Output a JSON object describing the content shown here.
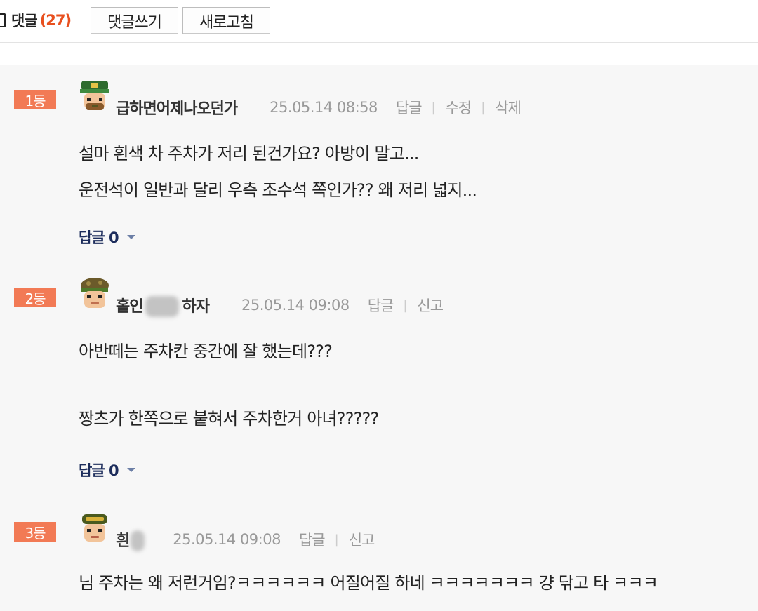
{
  "header": {
    "title": "댓글",
    "count": "(27)",
    "write_button": "댓글쓰기",
    "refresh_button": "새로고침"
  },
  "colors": {
    "rank_badge": "#f27a55",
    "count": "#e8501f",
    "reply_toggle": "#1d2d5c"
  },
  "comments": [
    {
      "rank": "1등",
      "nickname": "급하면어제나오던가",
      "date": "25.05.14 08:58",
      "actions": [
        "답글",
        "수정",
        "삭제"
      ],
      "lines": [
        "설마 흰색 차 주차가 저리 된건가요? 아방이 말고...",
        "운전석이 일반과 달리 우측 조수석 쪽인가?? 왜 저리 넓지..."
      ],
      "reply_label": "답글 0"
    },
    {
      "rank": "2등",
      "nickname_start": "홀인",
      "nickname_end": "하자",
      "date": "25.05.14 09:08",
      "actions": [
        "답글",
        "신고"
      ],
      "lines": [
        "아반떼는 주차칸 중간에 잘 했는데???",
        "",
        "짱츠가 한쪽으로 붙혀서 주차한거 아녀?????"
      ],
      "reply_label": "답글 0"
    },
    {
      "rank": "3등",
      "nickname_start": "흰",
      "date": "25.05.14 09:08",
      "actions": [
        "답글",
        "신고"
      ],
      "lines": [
        "님 주차는 왜 저런거임?ㅋㅋㅋㅋㅋㅋ 어질어질 하네 ㅋㅋㅋㅋㅋㅋㅋ 걍 닦고 타 ㅋㅋㅋ"
      ]
    }
  ]
}
